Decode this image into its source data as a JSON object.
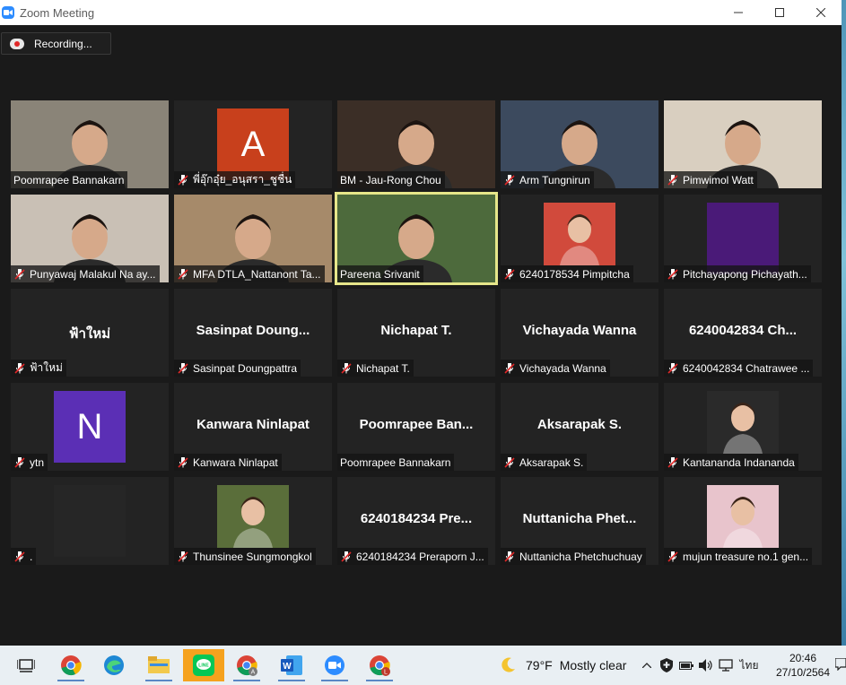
{
  "window": {
    "title": "Zoom Meeting"
  },
  "recording": {
    "label": "Recording..."
  },
  "participants": [
    {
      "name": "Poomrapee Bannakarn",
      "muted": false,
      "video": "photo",
      "bg": "#8a8478"
    },
    {
      "name": "พี่อุ๊กอุ๋ย_อนุสรา_ชูชื่น",
      "muted": true,
      "video": "avatar",
      "avatar_letter": "A",
      "avatar_color": "#c8401c"
    },
    {
      "name": "BM - Jau-Rong Chou",
      "muted": false,
      "video": "photo",
      "bg": "#3b2e26"
    },
    {
      "name": "Arm Tungnirun",
      "muted": true,
      "video": "photo",
      "bg": "#3c4a5e"
    },
    {
      "name": "Pimwimol Watt",
      "muted": true,
      "video": "photo",
      "bg": "#d9cfc0"
    },
    {
      "name": "Punyawaj Malakul Na ay...",
      "muted": true,
      "video": "photo",
      "bg": "#c9c0b5"
    },
    {
      "name": "MFA DTLA_Nattanont Ta...",
      "muted": true,
      "video": "photo",
      "bg": "#a68a6a"
    },
    {
      "name": "Pareena Srivanit",
      "muted": false,
      "video": "photo",
      "bg": "#4d6a3c",
      "speaking": true
    },
    {
      "name": "6240178534 Pimpitcha",
      "muted": true,
      "video": "thumb",
      "bg": "#d14a3c"
    },
    {
      "name": "Pitchayapong Pichayath...",
      "muted": true,
      "video": "avatar",
      "avatar_letter": "",
      "avatar_color": "#4a1a78"
    },
    {
      "name": "ฟ้าใหม่",
      "muted": true,
      "video": "off",
      "display": "ฟ้าใหม่"
    },
    {
      "name": "Sasinpat Doungpattra",
      "muted": true,
      "video": "off",
      "display": "Sasinpat  Doung..."
    },
    {
      "name": "Nichapat T.",
      "muted": true,
      "video": "off",
      "display": "Nichapat T."
    },
    {
      "name": "Vichayada Wanna",
      "muted": true,
      "video": "off",
      "display": "Vichayada Wanna"
    },
    {
      "name": "6240042834 Chatrawee ...",
      "muted": true,
      "video": "off",
      "display": "6240042834 Ch..."
    },
    {
      "name": "ytn",
      "muted": true,
      "video": "avatar",
      "avatar_letter": "N",
      "avatar_color": "#5b2fb5"
    },
    {
      "name": "Kanwara Ninlapat",
      "muted": true,
      "video": "off",
      "display": "Kanwara Ninlapat"
    },
    {
      "name": "Poomrapee Bannakarn",
      "muted": false,
      "video": "off",
      "display": "Poomrapee  Ban..."
    },
    {
      "name": "Aksarapak S.",
      "muted": true,
      "video": "off",
      "display": "Aksarapak S."
    },
    {
      "name": "Kantananda Indananda",
      "muted": true,
      "video": "thumb",
      "bg": "#2a2a2a"
    },
    {
      "name": ".",
      "muted": true,
      "video": "avatar",
      "avatar_letter": "",
      "avatar_color": "#262626"
    },
    {
      "name": "Thunsinee Sungmongkol",
      "muted": true,
      "video": "thumb",
      "bg": "#5a6e3a"
    },
    {
      "name": "6240184234 Preraporn J...",
      "muted": true,
      "video": "off",
      "display": "6240184234 Pre..."
    },
    {
      "name": "Nuttanicha Phetchuchuay",
      "muted": true,
      "video": "off",
      "display": "Nuttanicha  Phet..."
    },
    {
      "name": "mujun treasure no.1 gen...",
      "muted": true,
      "video": "thumb",
      "bg": "#e8c4cc"
    }
  ],
  "taskbar": {
    "apps": [
      "task-view",
      "chrome",
      "edge",
      "file-explorer",
      "line",
      "chrome-profile-a",
      "word",
      "zoom",
      "chrome-profile-l"
    ],
    "weather": {
      "temp": "79°F",
      "condition": "Mostly clear"
    },
    "language": "ไทย",
    "time": "20:46",
    "date": "27/10/2564"
  }
}
